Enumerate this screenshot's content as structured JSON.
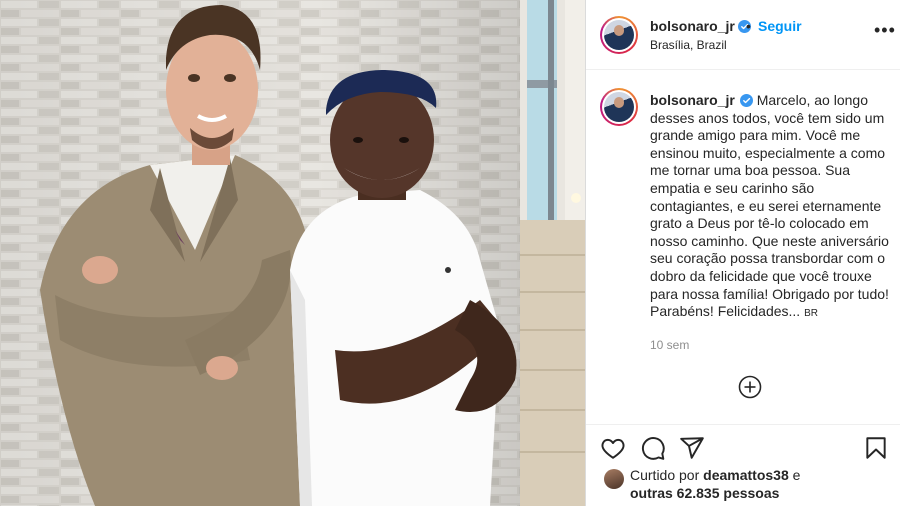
{
  "header": {
    "username": "bolsonaro_jr",
    "separator": "•",
    "follow_label": "Seguir",
    "location": "Brasília, Brazil",
    "more_icon": "more-options-icon",
    "more_text": "•••"
  },
  "caption": {
    "username": "bolsonaro_jr",
    "text": "Marcelo, ao longo desses anos todos, você tem sido um grande amigo para mim. Você me ensinou muito, especialmente a como me tornar uma boa pessoa. Sua empatia e seu carinho são contagiantes, e eu serei eternamente grato a Deus por tê-lo colocado em nosso caminho. Que neste aniversário seu coração possa transbordar com o dobro da felicidade que você trouxe para nossa família! Obrigado por tudo! Parabéns! Felicidades...",
    "flag": "BR"
  },
  "timestamp": "10 sem",
  "load_more_icon": "plus-circle-icon",
  "actions": [
    "heart-icon",
    "comment-icon",
    "share-icon",
    "bookmark-icon"
  ],
  "likes": {
    "prefix": "Curtido por",
    "user": "deamattos38",
    "conj": "e",
    "others": "outras 62.835 pessoas"
  },
  "colors": {
    "accent": "#0095f6",
    "verified": "#3897f0",
    "text": "#262626",
    "muted": "#8e8e8e"
  }
}
